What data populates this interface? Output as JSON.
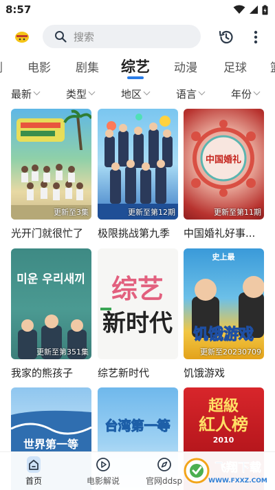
{
  "status": {
    "time": "8:57"
  },
  "search": {
    "placeholder": "搜索"
  },
  "categories": [
    "剧",
    "电影",
    "剧集",
    "综艺",
    "动漫",
    "足球",
    "篮"
  ],
  "filters": [
    "最新",
    "类型",
    "地区",
    "语言",
    "年份"
  ],
  "cards": [
    {
      "title": "光开门就很忙了",
      "badge": "更新至3集"
    },
    {
      "title": "极限挑战第九季",
      "badge": "更新至第12期"
    },
    {
      "title": "中国婚礼好事...",
      "badge": "更新至第11期"
    },
    {
      "title": "我家的熊孩子",
      "badge": "更新至第351集"
    },
    {
      "title": "综艺新时代",
      "badge": ""
    },
    {
      "title": "饥饿游戏",
      "badge": "更新至20230709"
    },
    {
      "title": "",
      "badge": ""
    },
    {
      "title": "",
      "badge": ""
    },
    {
      "title": "",
      "badge": ""
    }
  ],
  "poster_text": {
    "p3": "中国婚礼",
    "p4_korean": "미운 우리새끼",
    "p5_line1": "综艺",
    "p5_line2": "新时代",
    "p6_top": "史上最",
    "p6_main": "饥饿游戏",
    "p7": "世界第一等",
    "p8": "台湾第一等",
    "p9_line1": "超級",
    "p9_line2": "紅人榜",
    "p9_year": "2010"
  },
  "bottom_nav": [
    {
      "label": "首页",
      "icon": "home-icon"
    },
    {
      "label": "电影解说",
      "icon": "play-circle-icon"
    },
    {
      "label": "官网ddsp",
      "icon": "compass-icon"
    }
  ],
  "watermark": {
    "text": "飞翔下载",
    "url": "WWW.FXXZ.COM"
  },
  "colors": {
    "accent": "#2a7de8",
    "search_bg": "#eef0f3"
  }
}
